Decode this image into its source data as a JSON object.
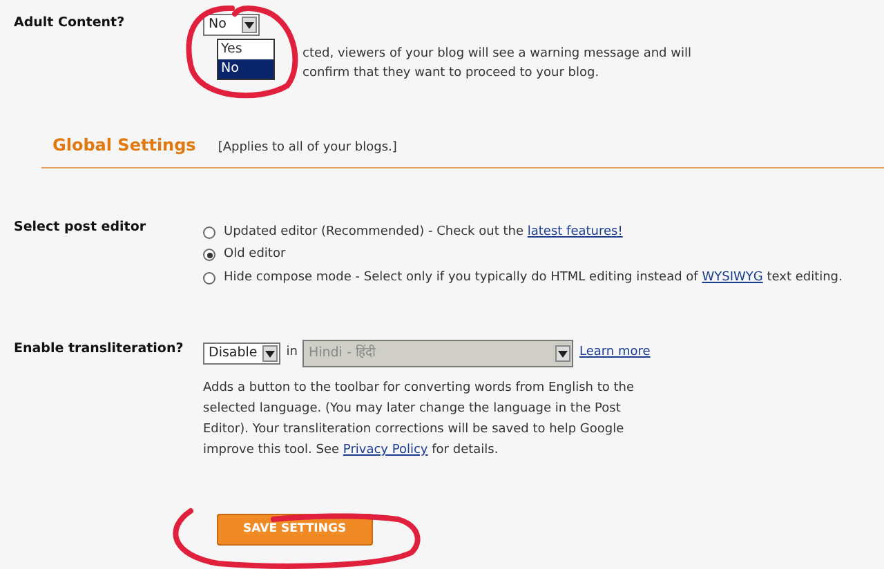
{
  "adult_content": {
    "label": "Adult Content?",
    "select": {
      "value": "No"
    },
    "options": [
      {
        "label": "Yes",
        "selected": false
      },
      {
        "label": "No",
        "selected": true
      }
    ],
    "description_lines": [
      "cted, viewers of your blog will see a warning message and will",
      "confirm that they want to proceed to your blog."
    ]
  },
  "global_settings": {
    "title": "Global Settings",
    "note": "[Applies to all of your blogs.]"
  },
  "post_editor": {
    "label": "Select post editor",
    "options": [
      {
        "before": "Updated editor (Recommended) - Check out the ",
        "link": "latest features!",
        "selected": false
      },
      {
        "before": "Old editor",
        "selected": true
      },
      {
        "before": "Hide compose mode - Select only if you typically do HTML editing instead of ",
        "link": "WYSIWYG",
        "after": " text editing.",
        "selected": false
      }
    ]
  },
  "transliteration": {
    "label": "Enable transliteration?",
    "mode": "Disable",
    "in": "in",
    "language": {
      "value": "Hindi - हिंदी",
      "disabled": true
    },
    "learn_more": "Learn more",
    "description": {
      "before": "Adds a button to the toolbar for converting words from English to the selected language. (You may later change the language in the Post Editor). Your transliteration corrections will be saved to help Google improve this tool. See ",
      "link": "Privacy Policy",
      "after": " for details."
    }
  },
  "save_button": "SAVE SETTINGS"
}
